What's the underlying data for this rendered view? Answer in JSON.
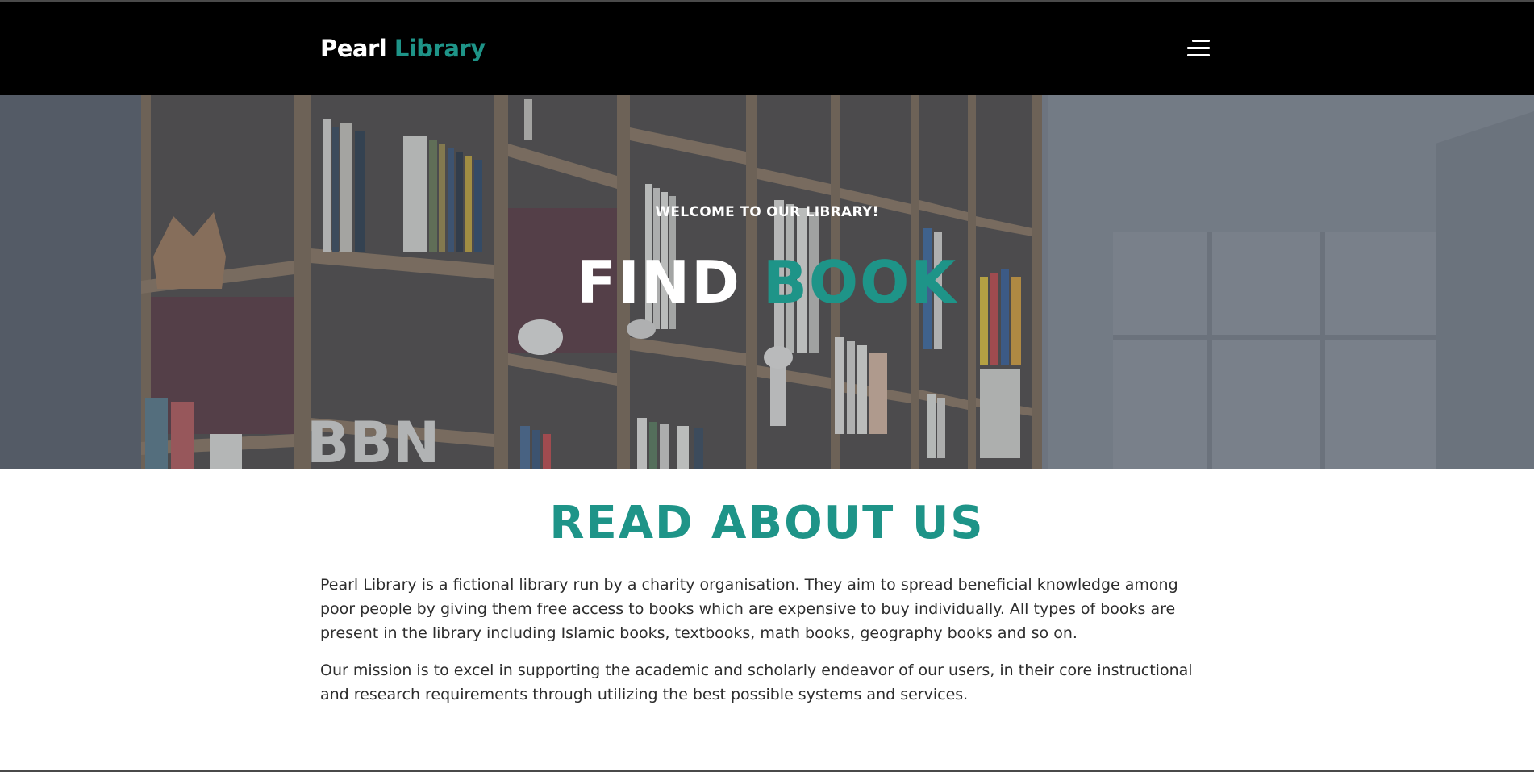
{
  "navbar": {
    "brand_main": "Pearl",
    "brand_accent": "Library",
    "menu_icon": "hamburger-menu-icon"
  },
  "hero": {
    "subtitle": "WELCOME TO OUR LIBRARY!",
    "title_main": "FIND",
    "title_accent": "BOOK"
  },
  "about": {
    "heading": "READ ABOUT US",
    "paragraph1": "Pearl Library is a fictional library run by a charity organisation. They aim to spread beneficial knowledge among poor people by giving them free access to books which are expensive to buy individually. All types of books are present in the library including Islamic books, textbooks, math books, geography books and so on.",
    "paragraph2": "Our mission is to excel in supporting the academic and scholarly endeavor of our users, in their core instructional and research requirements through utilizing the best possible systems and services."
  },
  "colors": {
    "accent": "#1e9488",
    "navbar_bg": "#000000",
    "text": "#2d2d2d"
  }
}
